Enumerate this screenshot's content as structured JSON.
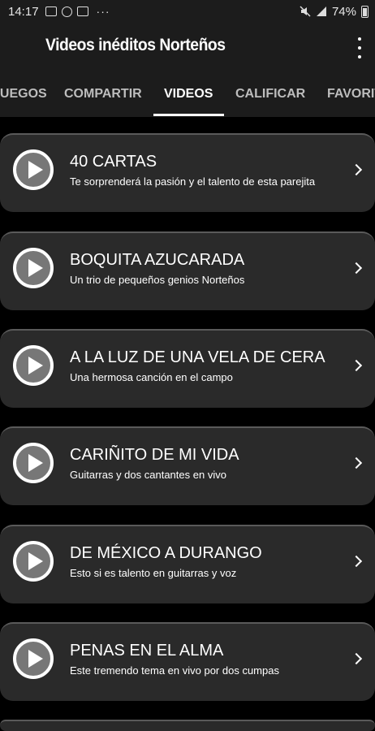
{
  "status": {
    "time": "14:17",
    "battery": "74%"
  },
  "app": {
    "title": "Videos inéditos Norteños"
  },
  "tabs": [
    {
      "label": "JUEGOS"
    },
    {
      "label": "COMPARTIR"
    },
    {
      "label": "VIDEOS"
    },
    {
      "label": "CALIFICAR"
    },
    {
      "label": "FAVORITOS"
    }
  ],
  "active_tab": "VIDEOS",
  "videos": [
    {
      "title": "40 CARTAS",
      "subtitle": "Te sorprenderá la pasión y el talento de esta parejita"
    },
    {
      "title": "BOQUITA AZUCARADA",
      "subtitle": "Un trio de pequeños genios Norteños"
    },
    {
      "title": "A LA LUZ DE UNA VELA DE CERA",
      "subtitle": "Una hermosa canción en el campo"
    },
    {
      "title": "CARIÑITO DE MI VIDA",
      "subtitle": "Guitarras y dos cantantes en vivo"
    },
    {
      "title": "DE MÉXICO A DURANGO",
      "subtitle": "Esto si es talento en guitarras y voz"
    },
    {
      "title": "PENAS EN EL ALMA",
      "subtitle": "Este tremendo tema en vivo por dos cumpas"
    }
  ]
}
